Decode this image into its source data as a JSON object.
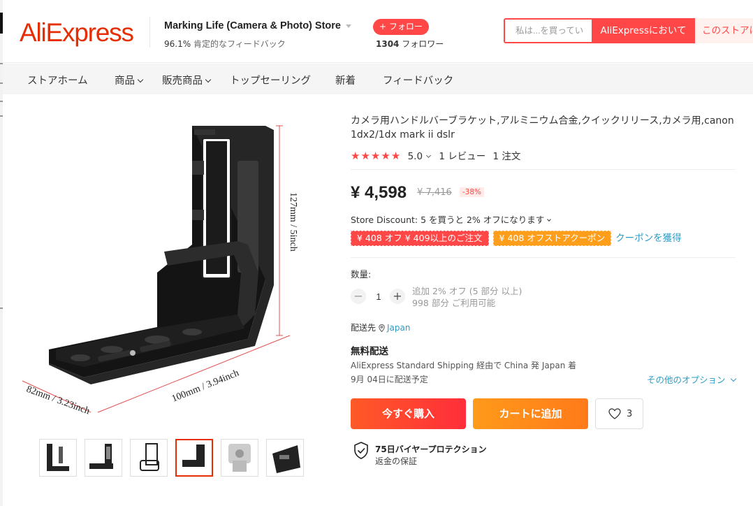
{
  "header": {
    "logo": "AliExpress",
    "store_name": "Marking Life (Camera & Photo) Store",
    "rating_percent": "96.1%",
    "rating_text": "肯定的なフィードバック",
    "follow_label": "+ フォロー",
    "followers_count": "1304",
    "followers_label": "フォロワー",
    "search_placeholder": "私は...を買ってい",
    "search_aliexpress_label": "AliExpressにおいて",
    "search_store_label": "このストアに"
  },
  "nav": {
    "items": [
      {
        "label": "ストアホーム",
        "dropdown": false
      },
      {
        "label": "商品",
        "dropdown": true
      },
      {
        "label": "販売商品",
        "dropdown": true
      },
      {
        "label": "トップセーリング",
        "dropdown": false
      },
      {
        "label": "新着",
        "dropdown": false
      },
      {
        "label": "フィードバック",
        "dropdown": false
      }
    ]
  },
  "gallery": {
    "dim_height": "127mm / 5inch",
    "dim_width": "100mm / 3.94inch",
    "dim_depth": "82mm / 3.23inch",
    "thumbnail_count": 6,
    "active_thumbnail": 4
  },
  "product": {
    "title": "カメラ用ハンドルバーブラケット,アルミニウム合金,クイックリリース,カメラ用,canon 1dx2/1dx mark ii dslr",
    "stars": 5,
    "rating_score": "5.0",
    "reviews": "1 レビュー",
    "orders": "1 注文",
    "price": "¥ 4,598",
    "old_price": "¥ 7,416",
    "discount": "-38%",
    "store_discount": "Store Discount: 5 を買うと 2% オフになります",
    "coupon_1": "¥ 408 オフ ¥ 409以上のご注文",
    "coupon_2": "¥ 408 オフストアクーポン",
    "coupon_link": "クーポンを獲得",
    "quantity_label": "数量:",
    "quantity_value": "1",
    "qty_note_1": "追加 2% オフ (5 部分 以上)",
    "qty_note_2": "998 部分 ご利用可能",
    "ship_to_label": "配送先",
    "ship_to_country": "Japan",
    "free_shipping": "無料配送",
    "shipping_method": "AliExpress Standard Shipping 経由で China 発 Japan 着",
    "delivery_date": "9月 04日に配送予定",
    "other_options": "その他のオプション",
    "buy_now": "今すぐ購入",
    "add_to_cart": "カートに追加",
    "wishlist_count": "3",
    "protection_title": "75日バイヤープロテクション",
    "protection_sub": "返金の保証"
  },
  "colors": {
    "brand": "#e62e04",
    "accent_red": "#ff4747",
    "link": "#2e9cc3",
    "coupon_orange": "#ff9e1a"
  }
}
